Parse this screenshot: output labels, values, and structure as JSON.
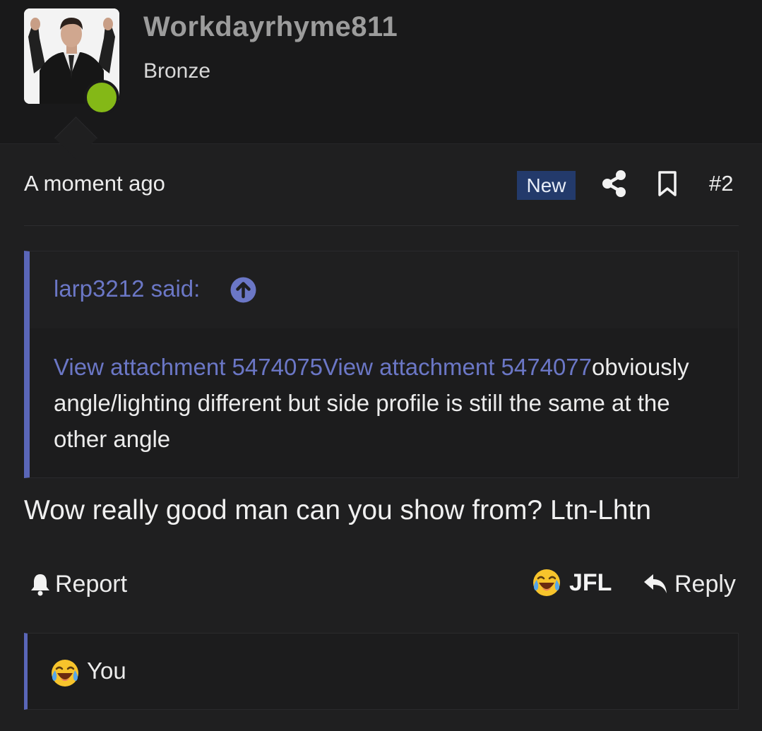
{
  "user": {
    "name": "Workdayrhyme811",
    "title": "Bronze",
    "online_color": "#84b817"
  },
  "post": {
    "time": "A moment ago",
    "new_badge": "New",
    "number": "#2",
    "text": "Wow really good man can you show from? Ltn-Lhtn"
  },
  "quote": {
    "author_label": "larp3212 said:",
    "link1": "View attachment 5474075",
    "link2": "View attachment 5474077",
    "text": "obviously angle/lighting different but side profile is still the same at the other angle"
  },
  "actions": {
    "report": "Report",
    "reaction": "JFL",
    "reply": "Reply"
  },
  "reactions": {
    "users": "You"
  },
  "icons": {
    "share": "share-icon",
    "bookmark": "bookmark-icon",
    "quote_jump": "arrow-up-circle-icon",
    "report": "bell-icon",
    "reaction": "laughing-crying-emoji-icon",
    "reply": "reply-arrow-icon"
  },
  "colors": {
    "accent": "#5a66b8",
    "link": "#6b77c6",
    "badge": "#233a6b",
    "background": "#1f1f20"
  }
}
